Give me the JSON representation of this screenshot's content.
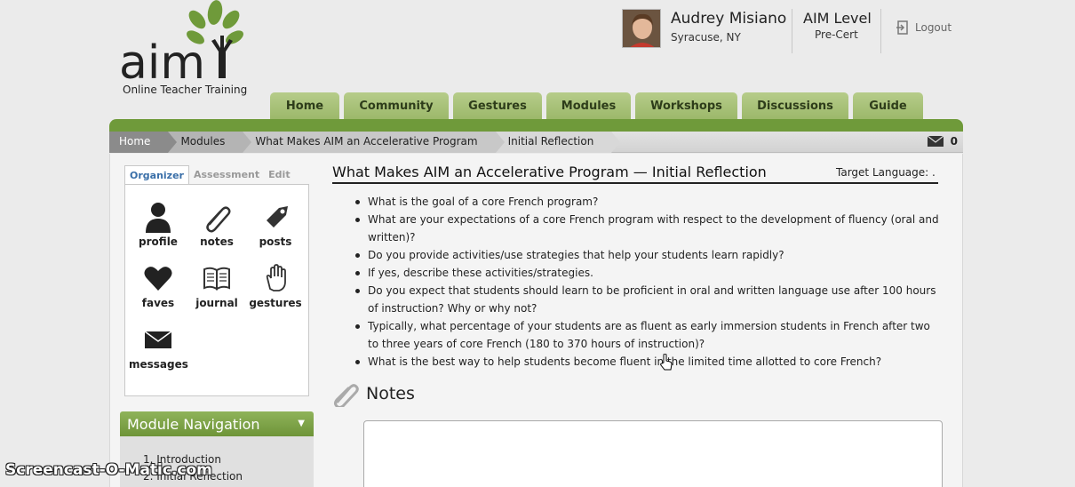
{
  "header": {
    "logo_tagline": "Online Teacher Training",
    "user_name": "Audrey Misiano",
    "user_location": "Syracuse, NY",
    "aim_level_label": "AIM Level",
    "aim_level_value": "Pre-Cert",
    "logout_label": "Logout"
  },
  "nav": {
    "tabs": [
      {
        "label": "Home"
      },
      {
        "label": "Community"
      },
      {
        "label": "Gestures"
      },
      {
        "label": "Modules"
      },
      {
        "label": "Workshops"
      },
      {
        "label": "Discussions"
      },
      {
        "label": "Guide"
      }
    ]
  },
  "breadcrumb": {
    "items": [
      {
        "label": "Home"
      },
      {
        "label": "Modules"
      },
      {
        "label": "What Makes AIM an Accelerative Program"
      },
      {
        "label": "Initial Reflection"
      }
    ],
    "message_count": "0"
  },
  "organizer": {
    "tabs": [
      {
        "label": "Organizer",
        "active": true
      },
      {
        "label": "Assessment",
        "active": false
      },
      {
        "label": "Edit",
        "active": false
      }
    ],
    "items": [
      {
        "label": "profile",
        "icon": "profile-icon"
      },
      {
        "label": "notes",
        "icon": "paperclip-icon"
      },
      {
        "label": "posts",
        "icon": "tag-icon"
      },
      {
        "label": "faves",
        "icon": "heart-icon"
      },
      {
        "label": "journal",
        "icon": "book-icon"
      },
      {
        "label": "gestures",
        "icon": "hand-icon"
      },
      {
        "label": "messages",
        "icon": "envelope-icon"
      }
    ]
  },
  "module_nav": {
    "title": "Module Navigation",
    "items": [
      {
        "label": "1.  Introduction"
      },
      {
        "label": "2.  Initial Reflection"
      }
    ]
  },
  "main": {
    "title": "What Makes AIM an Accelerative Program — Initial Reflection",
    "target_language": "Target Language: .",
    "questions": [
      "What is the goal of a core French program?",
      "What are your expectations of a core French program with respect to the development of fluency (oral and written)?",
      "Do you provide activities/use strategies that help your students learn rapidly?",
      "If yes, describe these activities/strategies.",
      "Do you expect that students should learn to be proficient in oral and written language use after 100 hours of instruction? Why or why not?",
      "Typically, what percentage of your students are as fluent as early immersion students in French after two to three years of core French (180 to 370 hours of instruction)?",
      "What is the best way to help students become fluent in the limited time allotted to core French?"
    ],
    "notes_title": "Notes"
  },
  "watermark": "Screencast-O-Matic.com",
  "colors": {
    "nav_tab": "#a9c37a",
    "brand_green": "#6f9a3a",
    "organizer_active": "#3a6fa8"
  }
}
